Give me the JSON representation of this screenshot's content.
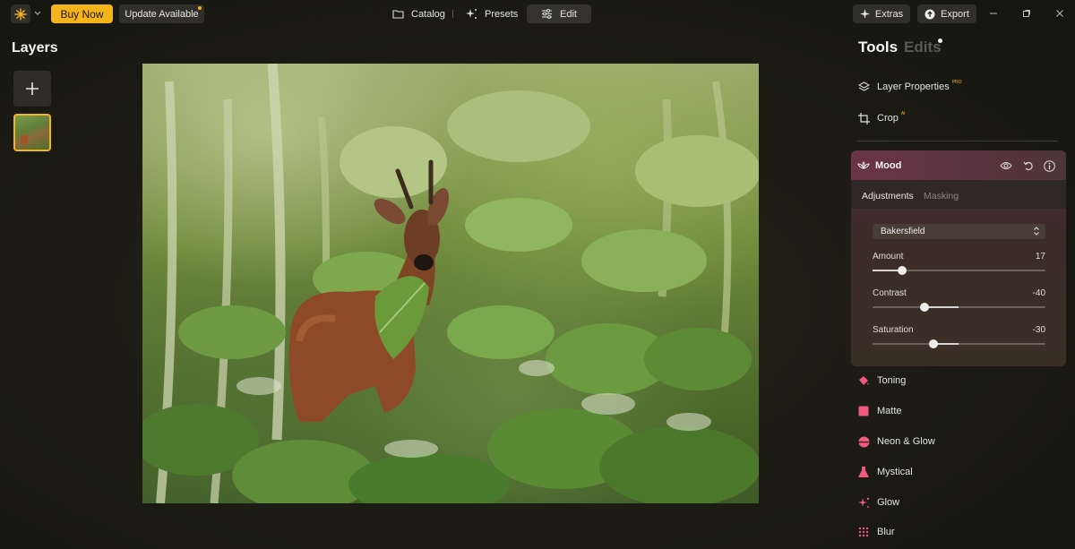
{
  "topbar": {
    "buy_now": "Buy Now",
    "update": "Update Available",
    "nav": [
      {
        "label": "Catalog",
        "icon": "folder-icon"
      },
      {
        "label": "Presets",
        "icon": "sparkle-icon"
      },
      {
        "label": "Edit",
        "icon": "sliders-icon"
      }
    ],
    "extras": "Extras",
    "export": "Export"
  },
  "layers": {
    "title": "Layers"
  },
  "tools": {
    "title": "Tools",
    "edits_tab": "Edits",
    "items": [
      {
        "label": "Layer Properties",
        "badge": "PRO",
        "icon": "layers-icon"
      },
      {
        "label": "Crop",
        "badge": "AI",
        "icon": "crop-icon"
      }
    ],
    "mood": {
      "title": "Mood",
      "tabs": [
        "Adjustments",
        "Masking"
      ],
      "preset": "Bakersfield",
      "sliders": [
        {
          "label": "Amount",
          "value": "17",
          "level": 17,
          "min": 0,
          "max": 100
        },
        {
          "label": "Contrast",
          "value": "-40",
          "level": -40,
          "min": -100,
          "max": 100
        },
        {
          "label": "Saturation",
          "value": "-30",
          "level": -30,
          "min": -100,
          "max": 100
        }
      ]
    },
    "effects": [
      {
        "label": "Toning",
        "icon": "bucket-icon"
      },
      {
        "label": "Matte",
        "icon": "square-icon"
      },
      {
        "label": "Neon & Glow",
        "icon": "half-circle-icon"
      },
      {
        "label": "Mystical",
        "icon": "flask-icon"
      },
      {
        "label": "Glow",
        "icon": "sparkle-icon"
      },
      {
        "label": "Blur",
        "icon": "dots-grid-icon"
      }
    ]
  },
  "colors": {
    "accent": "#f4b51c",
    "effect_icon": "#f0587e"
  }
}
